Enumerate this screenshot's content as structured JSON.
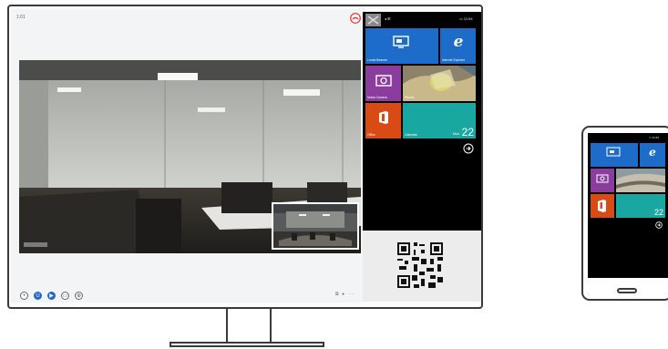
{
  "call": {
    "status_text": "1:01",
    "hangup_icon": "hangup-icon",
    "controls": [
      {
        "icon": "chat-icon",
        "glyph": "•"
      },
      {
        "icon": "mic-icon",
        "glyph": "U"
      },
      {
        "icon": "camera-icon",
        "glyph": "▶"
      },
      {
        "icon": "screen-share-icon",
        "glyph": "▭"
      },
      {
        "icon": "more-options-icon",
        "glyph": "⊕"
      }
    ],
    "status_icons_text": "⧉ ● ···"
  },
  "phone_panel": {
    "status_left": "◂ ⊞",
    "status_right": "▭ 11:54",
    "tiles": [
      {
        "label": "Lumia Beamer",
        "color": "#1e6cc9"
      },
      {
        "label": "Internet Explorer",
        "color": "#1e6cc9",
        "glyph": "e"
      },
      {
        "label": "Nokia Camera",
        "color": "#8a3d9c"
      },
      {
        "label": "Photos",
        "color": "#7a7054"
      },
      {
        "label": "Office",
        "color": "#d94b14"
      },
      {
        "label": "Calendar",
        "color": "#19a7a2",
        "day_name": "Mon",
        "day_number": "22"
      }
    ],
    "arrow_icon": "arrow-right-icon"
  },
  "handheld": {
    "status_right": "▭ 11:54",
    "day_number": "22"
  },
  "colors": {
    "accent_blue": "#1e6cc9",
    "purple": "#8a3d9c",
    "orange": "#d94b14",
    "teal": "#19a7a2",
    "call_control_blue": "#2466c6"
  }
}
